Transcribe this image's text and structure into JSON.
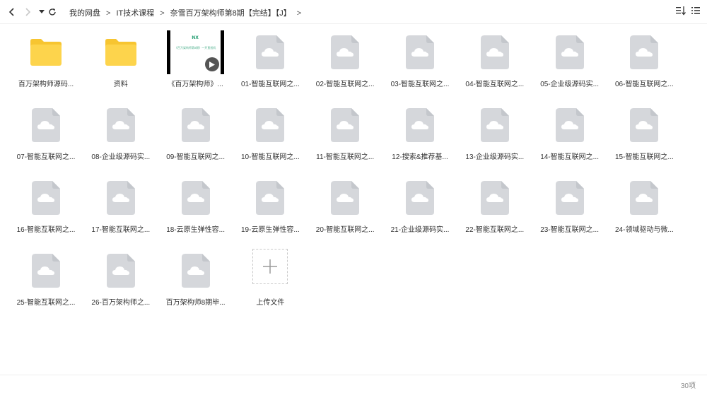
{
  "nav": {
    "back_icon": "chevron-left-icon",
    "forward_icon": "chevron-right-icon",
    "history_icon": "caret-down-icon",
    "refresh_icon": "refresh-icon"
  },
  "breadcrumb": {
    "items": [
      "我的网盘",
      "IT技术课程",
      "奈雪百万架构师第8期【完结】【J】"
    ],
    "separator": ">"
  },
  "toolbar": {
    "sort_icon": "sort-icon",
    "list_view_icon": "list-view-icon"
  },
  "files": [
    {
      "label": "百万架构师源码...",
      "type": "folder"
    },
    {
      "label": "资料",
      "type": "folder"
    },
    {
      "label": "《百万架构师》...",
      "type": "video",
      "thumb_title": "NX",
      "thumb_text": "《百万架构师第8期》一开直抵机"
    },
    {
      "label": "01-智能互联网之...",
      "type": "file"
    },
    {
      "label": "02-智能互联网之...",
      "type": "file"
    },
    {
      "label": "03-智能互联网之...",
      "type": "file"
    },
    {
      "label": "04-智能互联网之...",
      "type": "file"
    },
    {
      "label": "05-企业级源码实...",
      "type": "file"
    },
    {
      "label": "06-智能互联网之...",
      "type": "file"
    },
    {
      "label": "07-智能互联网之...",
      "type": "file"
    },
    {
      "label": "08-企业级源码实...",
      "type": "file"
    },
    {
      "label": "09-智能互联网之...",
      "type": "file"
    },
    {
      "label": "10-智能互联网之...",
      "type": "file"
    },
    {
      "label": "11-智能互联网之...",
      "type": "file"
    },
    {
      "label": "12-搜索&推荐基...",
      "type": "file"
    },
    {
      "label": "13-企业级源码实...",
      "type": "file"
    },
    {
      "label": "14-智能互联网之...",
      "type": "file"
    },
    {
      "label": "15-智能互联网之...",
      "type": "file"
    },
    {
      "label": "16-智能互联网之...",
      "type": "file"
    },
    {
      "label": "17-智能互联网之...",
      "type": "file"
    },
    {
      "label": "18-云原生弹性容...",
      "type": "file"
    },
    {
      "label": "19-云原生弹性容...",
      "type": "file"
    },
    {
      "label": "20-智能互联网之...",
      "type": "file"
    },
    {
      "label": "21-企业级源码实...",
      "type": "file"
    },
    {
      "label": "22-智能互联网之...",
      "type": "file"
    },
    {
      "label": "23-智能互联网之...",
      "type": "file"
    },
    {
      "label": "24-领域驱动与微...",
      "type": "file"
    },
    {
      "label": "25-智能互联网之...",
      "type": "file"
    },
    {
      "label": "26-百万架构师之...",
      "type": "file"
    },
    {
      "label": "百万架构师8期毕...",
      "type": "file"
    },
    {
      "label": "上传文件",
      "type": "upload"
    }
  ],
  "footer": {
    "count": "30项"
  },
  "colors": {
    "folder": "#fdd44c",
    "folder_tab": "#f7c531",
    "file_icon": "#d5d7db",
    "cloud": "#ffffff",
    "video_text": "#2aa176"
  }
}
